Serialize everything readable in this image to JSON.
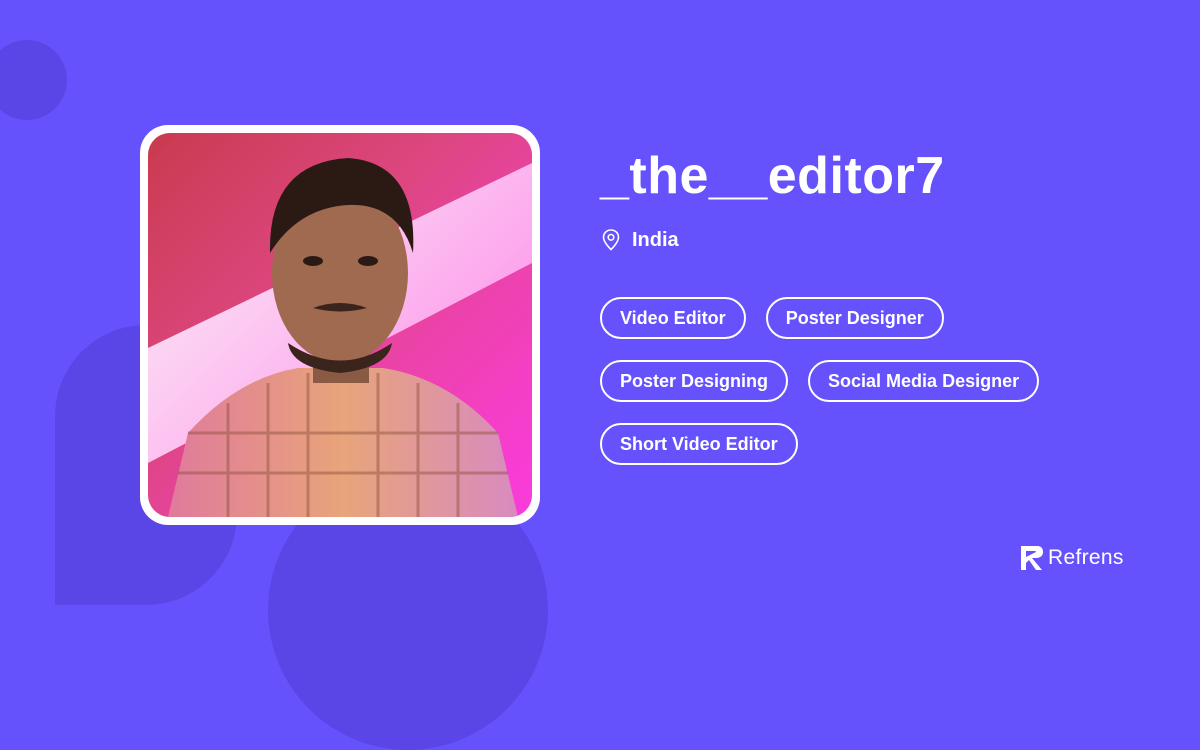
{
  "profile": {
    "username": "_the__editor7",
    "location": "India",
    "avatar_icon": "profile-photo"
  },
  "tags": [
    [
      "Video Editor",
      "Poster Designer"
    ],
    [
      "Poster Designing",
      "Social Media Designer"
    ],
    [
      "Short Video Editor"
    ]
  ],
  "brand": {
    "name": "Refrens",
    "icon": "refrens-logo-icon"
  },
  "colors": {
    "background": "#6652FC",
    "decoration": "#5A46E6",
    "text": "#FFFFFF"
  }
}
